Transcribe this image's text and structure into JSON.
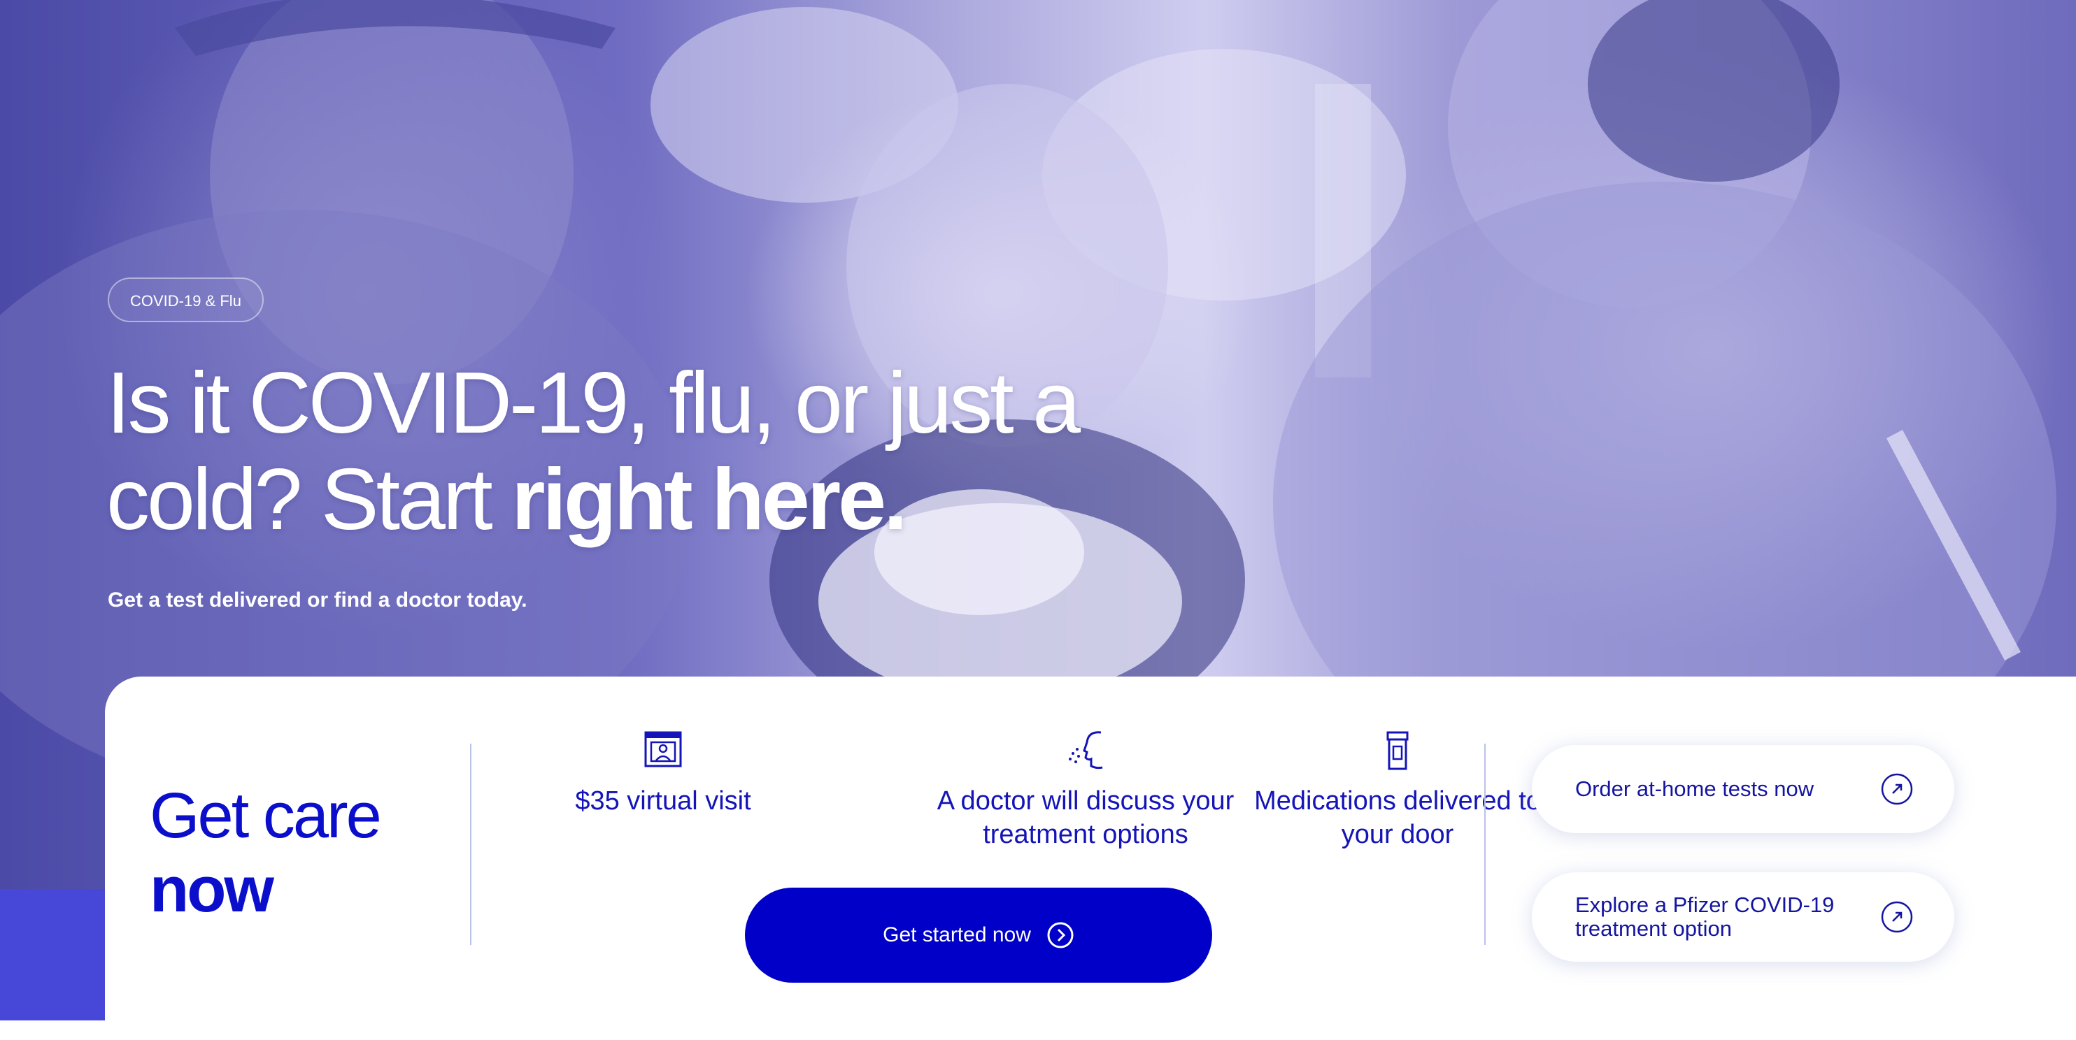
{
  "hero": {
    "tag": "COVID-19 & Flu",
    "headline_regular": "Is it COVID-19, flu, or just a cold? Start ",
    "headline_bold": "right here.",
    "subhead": "Get a test delivered or find a doctor today."
  },
  "care": {
    "title_line1": "Get care",
    "title_line2": "now",
    "features": [
      {
        "icon": "video-visit-icon",
        "label": "$35 virtual visit"
      },
      {
        "icon": "doctor-profile-icon",
        "label": "A doctor will discuss your treatment options"
      },
      {
        "icon": "pill-bottle-icon",
        "label": "Medications delivered to your door"
      }
    ],
    "cta_label": "Get started now",
    "links": [
      {
        "label": "Order at-home tests now"
      },
      {
        "label": "Explore a Pfizer COVID-19 treatment option"
      }
    ]
  },
  "colors": {
    "brand_blue": "#0000c8",
    "hero_tint": "#6f6cc2",
    "accent_text": "#1414b8"
  }
}
